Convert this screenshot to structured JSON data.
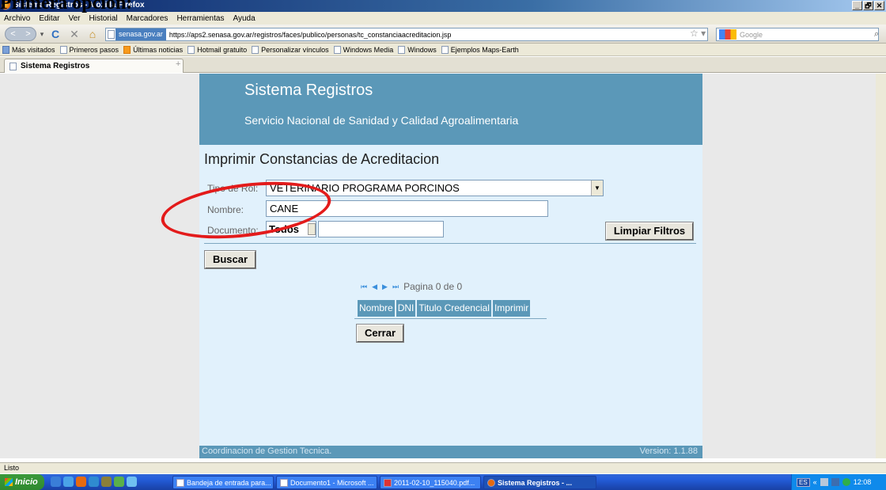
{
  "document_heading": "Primera opción:",
  "window": {
    "title": "Sistema Registros - Mozilla Firefox",
    "controls": {
      "minimize": "_",
      "maximize": "🗗",
      "close": "✕"
    }
  },
  "menu": [
    "Archivo",
    "Editar",
    "Ver",
    "Historial",
    "Marcadores",
    "Herramientas",
    "Ayuda"
  ],
  "nav": {
    "back": "<",
    "forward": ">",
    "dropdown": "▾",
    "reload": "C",
    "stop": "✕",
    "home": "⌂",
    "site_badge": "senasa.gov.ar",
    "url": "https://aps2.senasa.gov.ar/registros/faces/publico/personas/tc_constanciaacreditacion.jsp",
    "star": "☆ ▾",
    "search_placeholder": "Google",
    "search_icon": "⌕"
  },
  "bookmarks": [
    "Más visitados",
    "Primeros pasos",
    "Últimas noticias",
    "Hotmail gratuito",
    "Personalizar vínculos",
    "Windows Media",
    "Windows",
    "Ejemplos Maps-Earth"
  ],
  "tab": {
    "title": "Sistema Registros",
    "new_tab": "+"
  },
  "app": {
    "title": "Sistema Registros",
    "subtitle": "Servicio Nacional de Sanidad y Calidad Agroalimentaria",
    "page_title": "Imprimir Constancias de Acreditacion",
    "form": {
      "rol_label": "Tipo de Rol:",
      "rol_value": "VETERINARIO PROGRAMA PORCINOS",
      "nombre_label": "Nombre:",
      "nombre_value": "CANE",
      "documento_label": "Documento:",
      "documento_type": "Todos",
      "documento_value": "",
      "limpiar_label": "Limpiar Filtros",
      "buscar_label": "Buscar"
    },
    "pager": {
      "text": "Pagina 0 de 0",
      "first": "⏮",
      "prev": "◀",
      "next": "▶",
      "last": "⏭"
    },
    "grid_columns": [
      "Nombre",
      "DNI",
      "Titulo Credencial",
      "Imprimir"
    ],
    "cerrar_label": "Cerrar",
    "footer_left": "Coordinacion de Gestion Tecnica.",
    "footer_right": "Version: 1.1.88"
  },
  "status": "Listo",
  "taskbar": {
    "start": "Inicio",
    "tasks": [
      "Bandeja de entrada para...",
      "Documento1 - Microsoft ...",
      "2011-02-10_115040.pdf...",
      "Sistema Registros - ..."
    ],
    "lang": "ES",
    "tray_arrow": "«",
    "clock": "12:08"
  },
  "colors": {
    "banner": "#5b98b8",
    "panel": "#e1f1fc",
    "highlight_oval": "#e31b1b",
    "titlebar": "#0a246a"
  }
}
